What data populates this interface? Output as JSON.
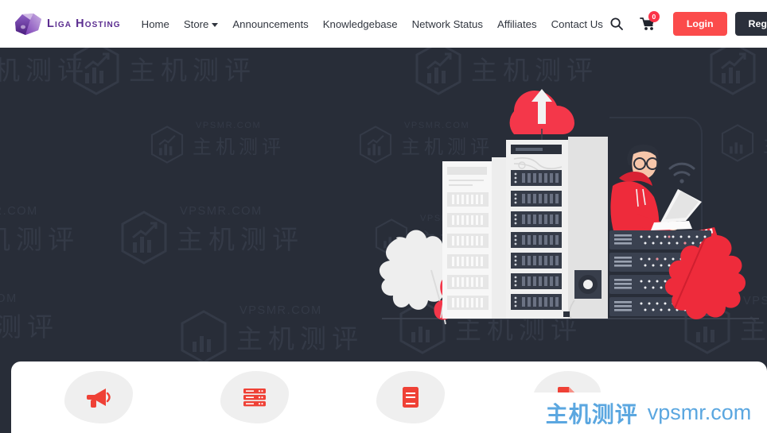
{
  "site": {
    "brand_name": "Liga Hosting",
    "logo_icon": "gem-crystal-icon",
    "background_color": "#282d38",
    "accent_red": "#fb4b4b",
    "brand_purple": "#5b2d90"
  },
  "header": {
    "nav_items": [
      {
        "label": "Home",
        "has_dropdown": false
      },
      {
        "label": "Store",
        "has_dropdown": true
      },
      {
        "label": "Announcements",
        "has_dropdown": false
      },
      {
        "label": "Knowledgebase",
        "has_dropdown": false
      },
      {
        "label": "Network Status",
        "has_dropdown": false
      },
      {
        "label": "Affiliates",
        "has_dropdown": false
      },
      {
        "label": "Contact Us",
        "has_dropdown": false
      }
    ],
    "search_icon": "search-icon",
    "cart_icon": "shopping-cart-icon",
    "cart_count": "0",
    "login_label": "Login",
    "register_label": "Register"
  },
  "hero": {
    "illustration_name": "data-center-server-racks-illustration",
    "elements": [
      "red-cloud-upload-icon",
      "white-server-rack",
      "grey-server-rack",
      "person-red-hoodie-laptop",
      "wifi-signal-icon",
      "dark-server-units",
      "white-leaf",
      "red-leaf"
    ]
  },
  "features": [
    {
      "icon": "megaphone-icon"
    },
    {
      "icon": "server-database-icon"
    },
    {
      "icon": "book-icon"
    },
    {
      "icon": "document-icon"
    }
  ],
  "watermarks": {
    "domain_text": "VPSMR.COM",
    "chinese_text": "主机测评",
    "logo_icon": "hexagon-chart-icon",
    "tile_color": "#343a47"
  },
  "watermark_banner": {
    "chinese_text": "主机测评",
    "domain_text": "vpsmr.com",
    "color": "#5ba7e0"
  }
}
